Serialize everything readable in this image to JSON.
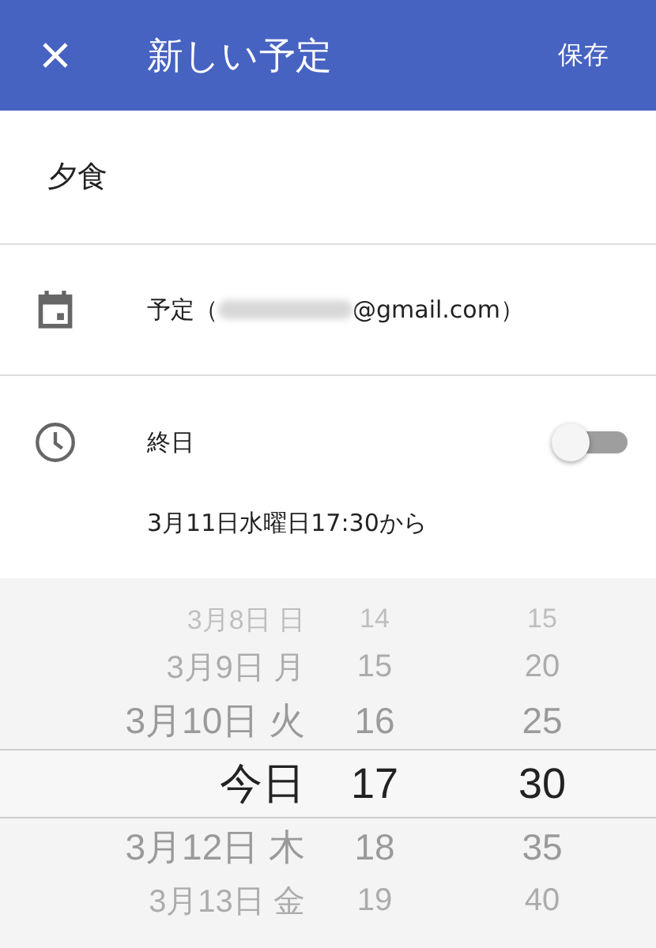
{
  "app_bar": {
    "title": "新しい予定",
    "save": "保存"
  },
  "event_title": "夕食",
  "calendar": {
    "prefix": "予定（",
    "email_suffix": "@gmail.com）",
    "redacted": true
  },
  "all_day": {
    "label": "終日",
    "on": false
  },
  "start": "3月11日水曜日17:30から",
  "picker": {
    "rows": [
      {
        "date": "3月8日 日",
        "hour": "14",
        "minute": "15",
        "selected": false
      },
      {
        "date": "3月9日 月",
        "hour": "15",
        "minute": "20",
        "selected": false
      },
      {
        "date": "3月10日 火",
        "hour": "16",
        "minute": "25",
        "selected": false
      },
      {
        "date": "今日",
        "hour": "17",
        "minute": "30",
        "selected": true
      },
      {
        "date": "3月12日 木",
        "hour": "18",
        "minute": "35",
        "selected": false
      },
      {
        "date": "3月13日 金",
        "hour": "19",
        "minute": "40",
        "selected": false
      }
    ]
  }
}
